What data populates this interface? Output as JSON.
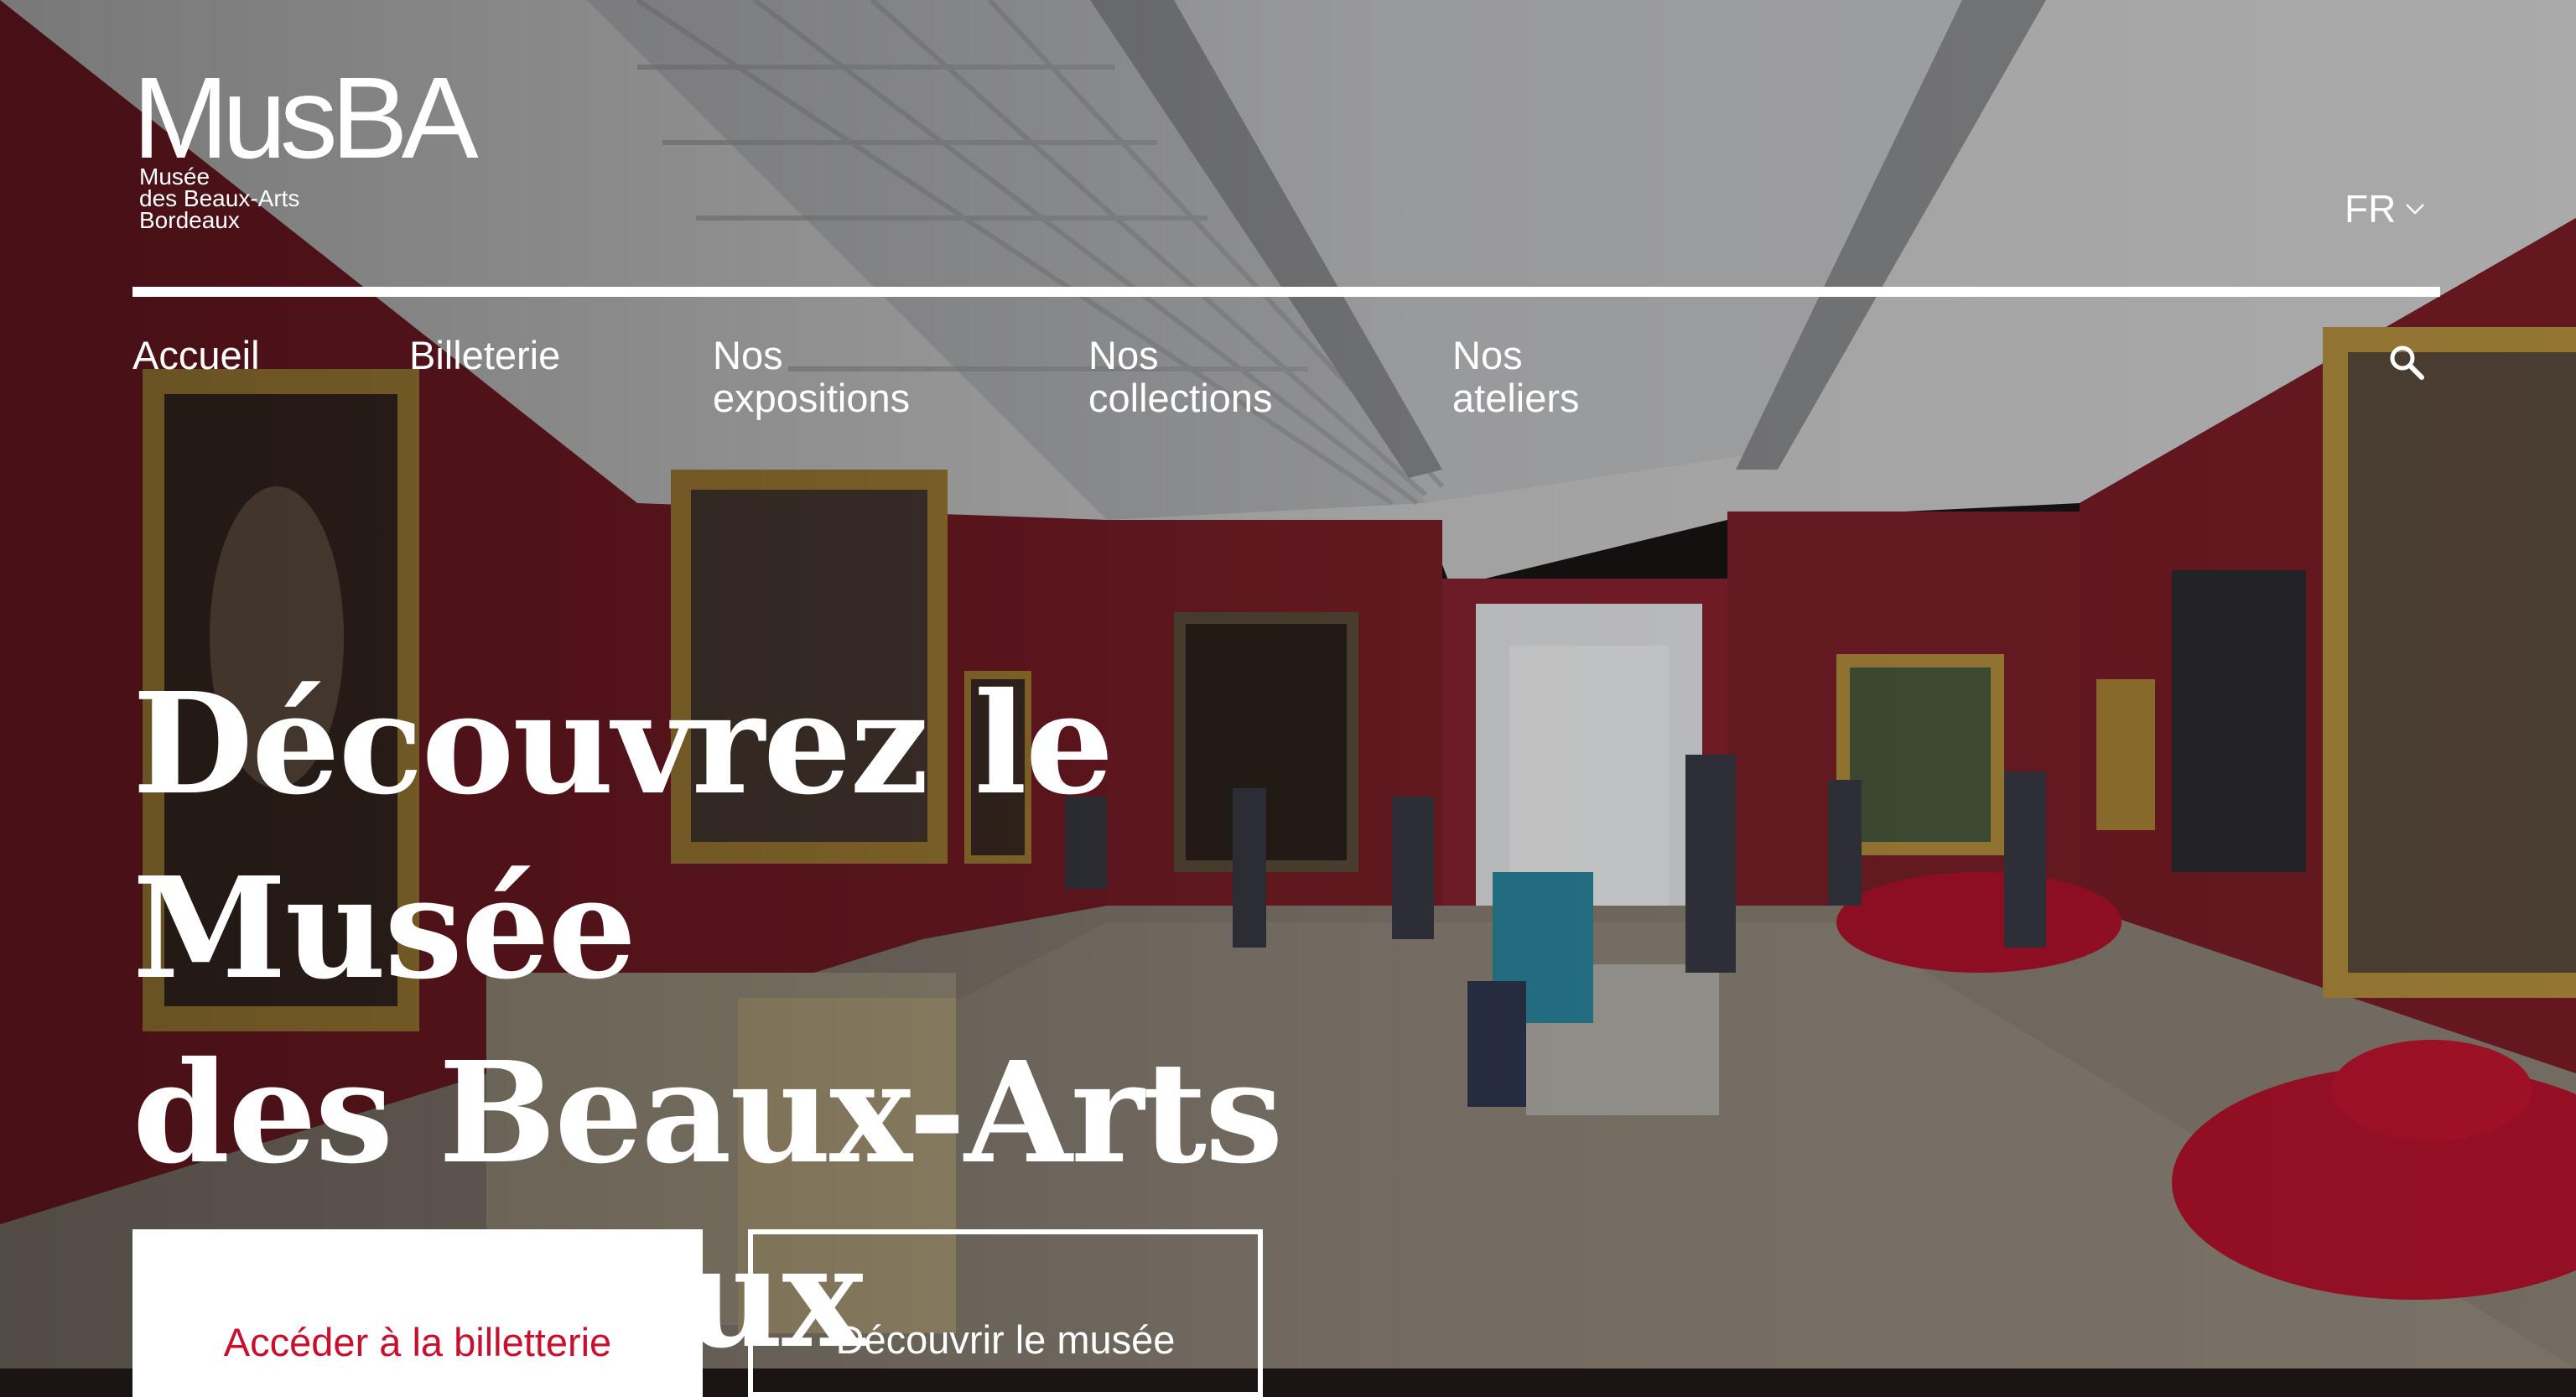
{
  "brand": {
    "logo_text": "MusBA",
    "subtitle_lines": [
      "Musée",
      "des Beaux-Arts",
      "Bordeaux"
    ]
  },
  "header": {
    "language": "FR",
    "language_icon": "chevron-down-icon"
  },
  "nav": {
    "items": [
      {
        "label": "Accueil"
      },
      {
        "label": "Billeterie"
      },
      {
        "label": "Nos\nexpositions"
      },
      {
        "label": "Nos\ncollections"
      },
      {
        "label": "Nos\nateliers"
      }
    ],
    "search_icon": "search-icon"
  },
  "hero": {
    "title": "Découvrez le Musée\ndes Beaux-Arts\nBordeaux",
    "primary_cta": "Accéder à la billetterie",
    "secondary_cta": "Découvrir le musée"
  },
  "colors": {
    "accent": "#c8102e",
    "text": "#ffffff",
    "wall": "#6e1a22"
  }
}
